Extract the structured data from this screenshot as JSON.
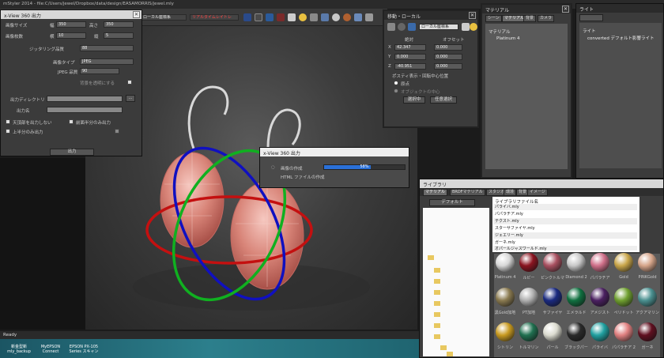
{
  "app": {
    "title": "mStyler 2014 - file:C/Users/jewel/Dropbox/data/design/EASAMORRIS/jewel.mly"
  },
  "toolbar": {
    "coord_select": "ローカル座標系",
    "render_select": "リアルタイムレイトレ",
    "tools": [
      "move-tool-icon",
      "rotate-tool-icon",
      "scale-tool-icon",
      "render-icon",
      "grid-icon",
      "sun-icon",
      "light-bulb-icon",
      "camera-icon",
      "material-icon",
      "sphere-icon",
      "cube-icon",
      "settings-icon"
    ]
  },
  "output_panel": {
    "title": "x-View 360 出力",
    "image_size_label": "画像サイズ",
    "width_label": "幅",
    "width_value": "350",
    "height_label": "高さ",
    "height_value": "350",
    "image_count_label": "画像枚数",
    "horiz_label": "横",
    "horiz_value": "10",
    "vert_label": "縦",
    "vert_value": "5",
    "jitter_label": "ジッタリング品質",
    "jitter_value": "88",
    "image_type_label": "画像タイプ",
    "image_type_value": "JPEG",
    "jpeg_quality_label": "JPEG 品質",
    "jpeg_quality_value": "90",
    "transparent_bg_label": "背景を透明にする",
    "output_dir_label": "出力ディレクトリ",
    "output_name_label": "出力名",
    "browse_label": "...",
    "no_sky_label": "天頂部を出力しない",
    "front_only_label": "前面半分のみ出力",
    "upper_only_label": "上半分のみ出力",
    "output_button": "出力"
  },
  "transform_panel": {
    "title": "移動・ローカル",
    "coord_select": "ローカル座標系",
    "coord_header": "絶対",
    "offset_header": "オフセット",
    "x_label": "X",
    "x_value": "42.347",
    "x_offset": "0.000",
    "y_label": "Y",
    "y_value": "0.000",
    "y_offset": "0.000",
    "z_label": "Z",
    "z_value": "-40.951",
    "z_offset": "0.000",
    "pivot_label": "ポスティ表示・回転中心位置",
    "origin_label": "原点",
    "object_center_label": "オブジェクトの中心",
    "selected_button": "選択中",
    "any_select_button": "任意選択"
  },
  "material_panel": {
    "title": "マテリアル",
    "tabs": [
      "シーン",
      "マテリアル",
      "背景",
      "カメラ"
    ],
    "tree_root": "マテリアル",
    "tree_child": "Platinum 4"
  },
  "light_panel": {
    "title": "ライト",
    "tree_root": "ライト",
    "tree_child": "converted デフォルト影響ライト"
  },
  "progress_dialog": {
    "title": "x-View 360 出力",
    "creating_label": "画像の作成",
    "progress_percent": 58,
    "progress_text": "58%",
    "html_label": "HTML ファイルの作成"
  },
  "library_panel": {
    "title": "ライブラリ",
    "tabs": [
      "マテリアル",
      "BRDFマテリアル",
      "スタジオ",
      "環境",
      "背景",
      "イメージ"
    ],
    "default_button": "デフォルト",
    "file_header": "ライブラリファイル名",
    "files": [
      "パライバ.mly",
      "パパラチア.mly",
      "テクスト.mly",
      "スターサファイヤ.mly",
      "ジェエリー.mly",
      "ガーネ.mly",
      "オパールジャスワールド.mly"
    ],
    "materials": [
      {
        "name": "Platinum 4",
        "color": "#d8d8d8"
      },
      {
        "name": "ルビー",
        "color": "#8a1420"
      },
      {
        "name": "ピンクトルマリン",
        "color": "#a85060"
      },
      {
        "name": "Diamond 2",
        "color": "#c8c8c8"
      },
      {
        "name": "パパラチア",
        "color": "#d0708a"
      },
      {
        "name": "Gold",
        "color": "#c9a64a"
      },
      {
        "name": "PINKGold",
        "color": "#d6a58a"
      },
      {
        "name": "黒Gold加地",
        "color": "#8a7a50"
      },
      {
        "name": "PT加地",
        "color": "#b0b0b0"
      },
      {
        "name": "サファイヤ",
        "color": "#1a2a80"
      },
      {
        "name": "エメラルド",
        "color": "#107040"
      },
      {
        "name": "アメジスト",
        "color": "#4a2060"
      },
      {
        "name": "ペリドット",
        "color": "#70a030"
      },
      {
        "name": "アクアマリン",
        "color": "#4a9090"
      },
      {
        "name": "シトリン",
        "color": "#c89a20"
      },
      {
        "name": "トルマリン",
        "color": "#207050"
      },
      {
        "name": "パール",
        "color": "#dcdcd0"
      },
      {
        "name": "ブラックパール",
        "color": "#2a2a2a"
      },
      {
        "name": "パライバ",
        "color": "#20a0a0"
      },
      {
        "name": "パパラチア 2",
        "color": "#e08080"
      },
      {
        "name": "ガーネ",
        "color": "#601020"
      }
    ]
  },
  "status": {
    "text": "Ready"
  },
  "taskbar": {
    "items": [
      {
        "line1": "新金型新",
        "line2": "mly_backup"
      },
      {
        "line1": "MyEPSON",
        "line2": "Connect"
      },
      {
        "line1": "EPSON PX-105",
        "line2": "Series スキャン"
      }
    ]
  }
}
